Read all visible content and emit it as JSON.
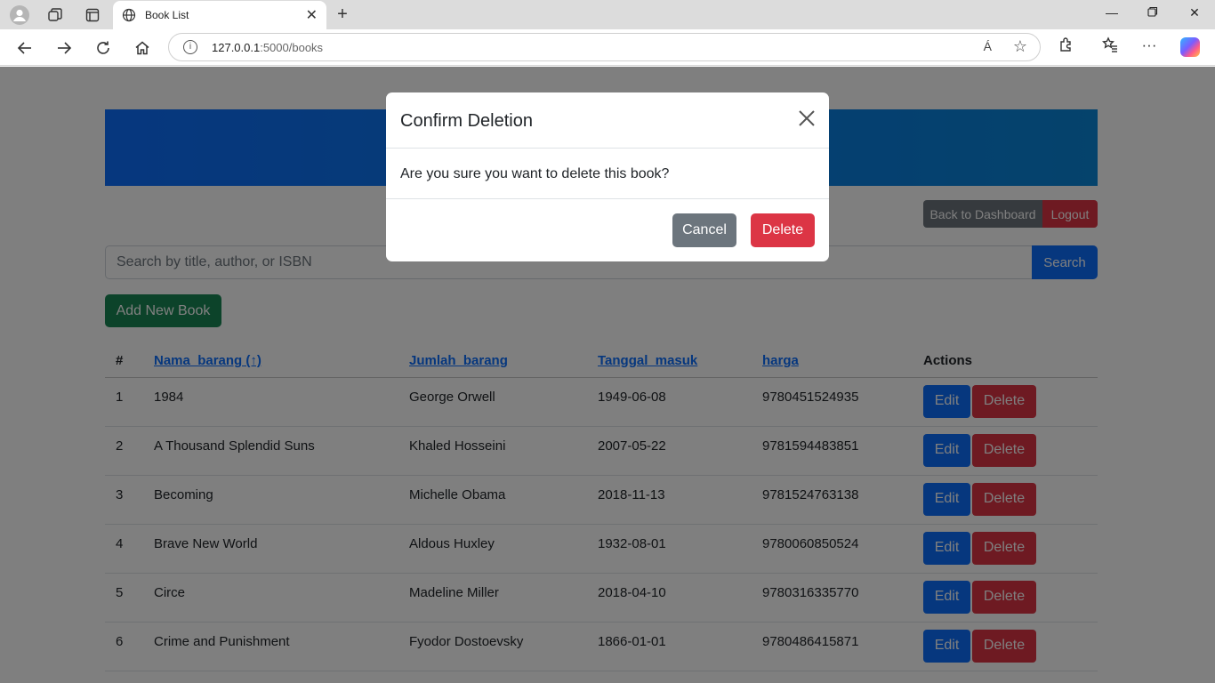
{
  "browser": {
    "tab_title": "Book List",
    "url_host": "127.0.0.1",
    "url_path": ":5000/books",
    "read_aloud_label": "Á"
  },
  "header_buttons": {
    "dashboard": "Back to Dashboard",
    "logout": "Logout"
  },
  "search": {
    "placeholder": "Search by title, author, or ISBN",
    "button": "Search"
  },
  "add_button": "Add New Book",
  "table": {
    "columns": [
      "#",
      "Nama_barang (↑)",
      "Jumlah_barang",
      "Tanggal_masuk",
      "harga",
      "Actions"
    ],
    "rows": [
      {
        "no": "1",
        "title": "1984",
        "author": "George Orwell",
        "date": "1949-06-08",
        "isbn": "9780451524935"
      },
      {
        "no": "2",
        "title": "A Thousand Splendid Suns",
        "author": "Khaled Hosseini",
        "date": "2007-05-22",
        "isbn": "9781594483851"
      },
      {
        "no": "3",
        "title": "Becoming",
        "author": "Michelle Obama",
        "date": "2018-11-13",
        "isbn": "9781524763138"
      },
      {
        "no": "4",
        "title": "Brave New World",
        "author": "Aldous Huxley",
        "date": "1932-08-01",
        "isbn": "9780060850524"
      },
      {
        "no": "5",
        "title": "Circe",
        "author": "Madeline Miller",
        "date": "2018-04-10",
        "isbn": "9780316335770"
      },
      {
        "no": "6",
        "title": "Crime and Punishment",
        "author": "Fyodor Dostoevsky",
        "date": "1866-01-01",
        "isbn": "9780486415871"
      }
    ],
    "edit_label": "Edit",
    "delete_label": "Delete"
  },
  "modal": {
    "title": "Confirm Deletion",
    "message": "Are you sure you want to delete this book?",
    "cancel": "Cancel",
    "confirm": "Delete"
  },
  "colors": {
    "primary": "#0d6efd",
    "danger": "#dc3545",
    "secondary": "#6c757d",
    "success": "#198754"
  }
}
